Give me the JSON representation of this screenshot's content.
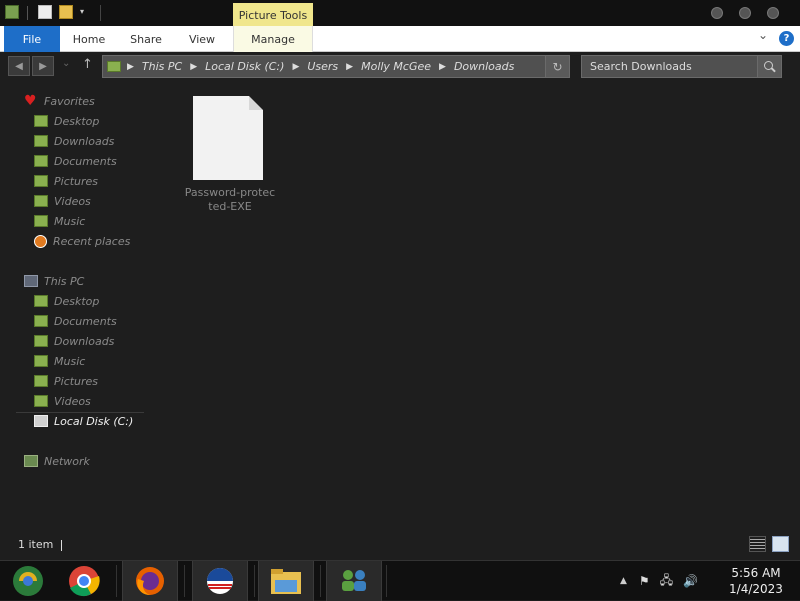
{
  "window": {
    "contextual_tab_group": "Picture Tools"
  },
  "ribbon": {
    "tabs": [
      {
        "label": "File"
      },
      {
        "label": "Home"
      },
      {
        "label": "Share"
      },
      {
        "label": "View"
      },
      {
        "label": "Manage"
      }
    ],
    "expand_chevron": "⌄",
    "help": "?"
  },
  "address_bar": {
    "crumbs": [
      "This PC",
      "Local Disk (C:)",
      "Users",
      "Molly McGee",
      "Downloads"
    ],
    "search_placeholder": "Search Downloads"
  },
  "nav_pane": {
    "favorites_label": "Favorites",
    "favorites": [
      "Desktop",
      "Downloads",
      "Documents",
      "Pictures",
      "Videos",
      "Music",
      "Recent places"
    ],
    "this_pc_label": "This PC",
    "this_pc": [
      "Desktop",
      "Documents",
      "Downloads",
      "Music",
      "Pictures",
      "Videos",
      "Local Disk (C:)"
    ],
    "network_label": "Network"
  },
  "content": {
    "files": [
      {
        "name_line1": "Password-protec",
        "name_line2": "ted-EXE",
        "icon": "blank-file-icon"
      }
    ]
  },
  "status_bar": {
    "item_count": "1 item"
  },
  "taskbar": {
    "apps": [
      "start-orb-icon",
      "chrome-icon",
      "firefox-icon",
      "obama-campaign-icon",
      "file-explorer-icon",
      "network-users-icon"
    ],
    "tray_chevron": "▲",
    "time": "5:56 AM",
    "date": "1/4/2023"
  },
  "colors": {
    "file_tab": "#1e6ec8",
    "contextual_tab": "#f0e68c",
    "background": "#1e1e1e",
    "folder_green": "#8ab04f"
  }
}
